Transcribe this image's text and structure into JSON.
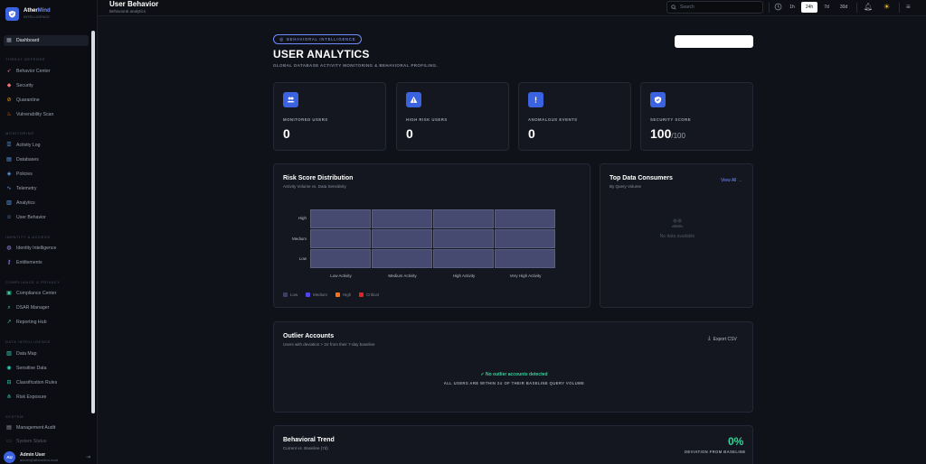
{
  "brand": {
    "name_main": "Ather",
    "name_accent": "Mind",
    "tagline": "INTELLIGENCE"
  },
  "sidebar": {
    "dashboard": "Dashboard",
    "sections": [
      "Threat Defense",
      "Monitoring",
      "Identity & Access",
      "Compliance & Privacy",
      "Data Intelligence",
      "System"
    ],
    "threat_items": [
      "Behavior Center",
      "Security",
      "Quarantine",
      "Vulnerability Scan"
    ],
    "monitoring_items": [
      "Activity Log",
      "Databases",
      "Policies",
      "Telemetry",
      "Analytics",
      "User Behavior"
    ],
    "identity_items": [
      "Identity Intelligence",
      "Entitlements"
    ],
    "compliance_items": [
      "Compliance Center",
      "DSAR Manager",
      "Reporting Hub"
    ],
    "data_items": [
      "Data Map",
      "Sensitive Data",
      "Classification Rules",
      "Risk Exposure"
    ],
    "system_items": [
      "Management Audit",
      "System Status"
    ],
    "user": {
      "initials": "AU",
      "name": "Admin User",
      "email": "admin@athermind.local"
    }
  },
  "header": {
    "title": "User Behavior",
    "subtitle": "Behavioral analytics",
    "search_placeholder": "Search",
    "ranges": [
      "1h",
      "24h",
      "7d",
      "30d"
    ],
    "selected_range": "24h"
  },
  "hero": {
    "pill": "BEHAVIORAL INTELLIGENCE",
    "title": "USER ANALYTICS",
    "subtitle": "GLOBAL DATABASE ACTIVITY MONITORING & BEHAVIORAL PROFILING."
  },
  "stats": [
    {
      "label": "MONITORED USERS",
      "value": "0",
      "suffix": "",
      "icon": "users-icon"
    },
    {
      "label": "HIGH RISK USERS",
      "value": "0",
      "suffix": "",
      "icon": "warning-icon"
    },
    {
      "label": "ANOMALOUS EVENTS",
      "value": "0",
      "suffix": "",
      "icon": "alert-icon"
    },
    {
      "label": "SECURITY SCORE",
      "value": "100",
      "suffix": "/100",
      "icon": "shield-icon"
    }
  ],
  "risk": {
    "title": "Risk Score Distribution",
    "subtitle": "Activity Volume vs. Data Sensitivity",
    "rows": [
      "High",
      "Medium",
      "Low"
    ],
    "cols": [
      "Low Activity",
      "Medium Activity",
      "High Activity",
      "Very High Activity"
    ],
    "legend": [
      {
        "label": "Low",
        "color": "#3a3f6b"
      },
      {
        "label": "Medium",
        "color": "#4f46e5"
      },
      {
        "label": "High",
        "color": "#f97316"
      },
      {
        "label": "Critical",
        "color": "#dc2626"
      }
    ],
    "cell_color": "#464a70"
  },
  "consumers": {
    "title": "Top Data Consumers",
    "subtitle": "By Query Volume",
    "view_all": "View All →",
    "empty": "No data available"
  },
  "outliers": {
    "title": "Outlier Accounts",
    "subtitle": "Users with deviation > 2σ from their 7-day baseline",
    "export": "Export CSV",
    "ok": "✓ No outlier accounts detected",
    "ok_sub": "ALL USERS ARE WITHIN 2σ OF THEIR BASELINE QUERY VOLUME"
  },
  "trend": {
    "title": "Behavioral Trend",
    "subtitle": "Current vs. Baseline (7d)",
    "value": "0%",
    "caption": "DEVIATION FROM BASELINE"
  },
  "colors": {
    "accent": "#3b63e0",
    "success": "#34d399",
    "bg": "#10121a",
    "card": "#14171f"
  }
}
